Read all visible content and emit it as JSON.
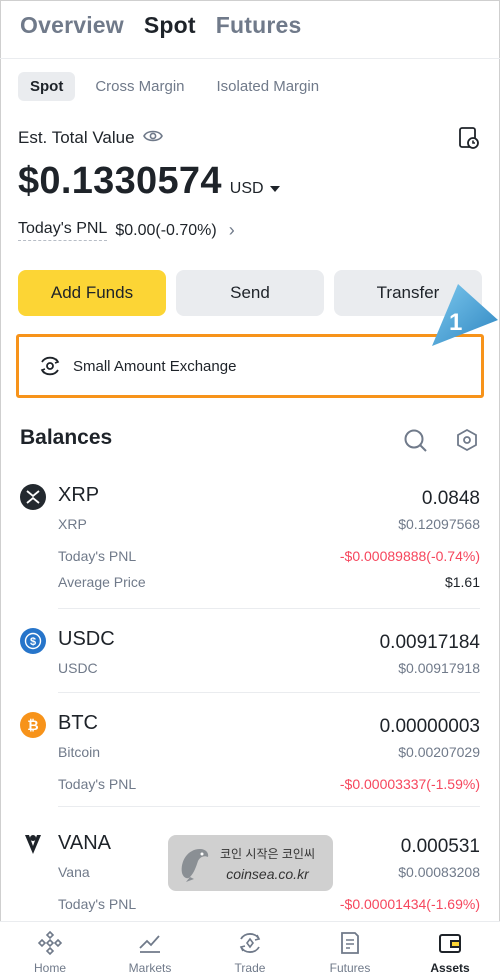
{
  "top_tabs": [
    "Overview",
    "Spot",
    "Futures"
  ],
  "sub_tabs": [
    "Spot",
    "Cross Margin",
    "Isolated Margin"
  ],
  "est_total_label": "Est. Total Value",
  "total_value": "$0.1330574",
  "currency": "USD",
  "todays_pnl_label": "Today's PNL",
  "todays_pnl_value": "$0.00(-0.70%)",
  "buttons": {
    "add_funds": "Add Funds",
    "send": "Send",
    "transfer": "Transfer"
  },
  "small_amount_exchange": "Small Amount Exchange",
  "annotation_number": "1",
  "balances_title": "Balances",
  "coins": [
    {
      "symbol": "XRP",
      "name": "XRP",
      "amount": "0.0848",
      "usd": "$0.12097568",
      "pnl_label": "Today's PNL",
      "pnl": "-$0.00089888(-0.74%)",
      "avg_label": "Average Price",
      "avg": "$1.61"
    },
    {
      "symbol": "USDC",
      "name": "USDC",
      "amount": "0.00917184",
      "usd": "$0.00917918"
    },
    {
      "symbol": "BTC",
      "name": "Bitcoin",
      "amount": "0.00000003",
      "usd": "$0.00207029",
      "pnl_label": "Today's PNL",
      "pnl": "-$0.00003337(-1.59%)"
    },
    {
      "symbol": "VANA",
      "name": "Vana",
      "amount": "0.000531",
      "usd": "$0.00083208",
      "pnl_label": "Today's PNL",
      "pnl": "-$0.00001434(-1.69%)"
    }
  ],
  "watermark": {
    "korean": "코인 시작은 코인씨",
    "english": "coinsea.co.kr"
  },
  "bottom_nav": [
    "Home",
    "Markets",
    "Trade",
    "Futures",
    "Assets"
  ],
  "colors": {
    "accent": "#fcd535",
    "negative": "#f6465d",
    "highlight": "#f7931a",
    "annotation": "#4aa8d8"
  }
}
